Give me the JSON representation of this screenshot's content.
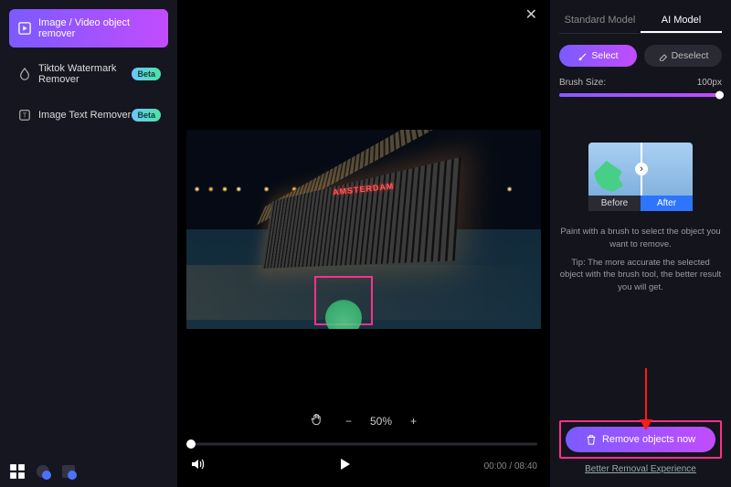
{
  "sidebar": {
    "items": [
      {
        "label": "Image / Video object remover",
        "active": true
      },
      {
        "label": "Tiktok Watermark Remover",
        "beta": "Beta"
      },
      {
        "label": "Image Text Remover",
        "beta": "Beta"
      }
    ]
  },
  "video": {
    "sign_text": "AMSTERDAM",
    "zoom_pct": "50%",
    "timecode_current": "00:00",
    "timecode_total": "08:40"
  },
  "panel": {
    "tabs": {
      "standard": "Standard Model",
      "ai": "AI Model"
    },
    "select_label": "Select",
    "deselect_label": "Deselect",
    "brush_label": "Brush Size:",
    "brush_value": "100px",
    "preview": {
      "before": "Before",
      "after": "After"
    },
    "hint1": "Paint with a brush to select the object you want to remove.",
    "hint2": "Tip: The more accurate the selected object with the brush tool, the better result you will get.",
    "remove_label": "Remove objects now",
    "better_link": "Better Removal Experience"
  }
}
